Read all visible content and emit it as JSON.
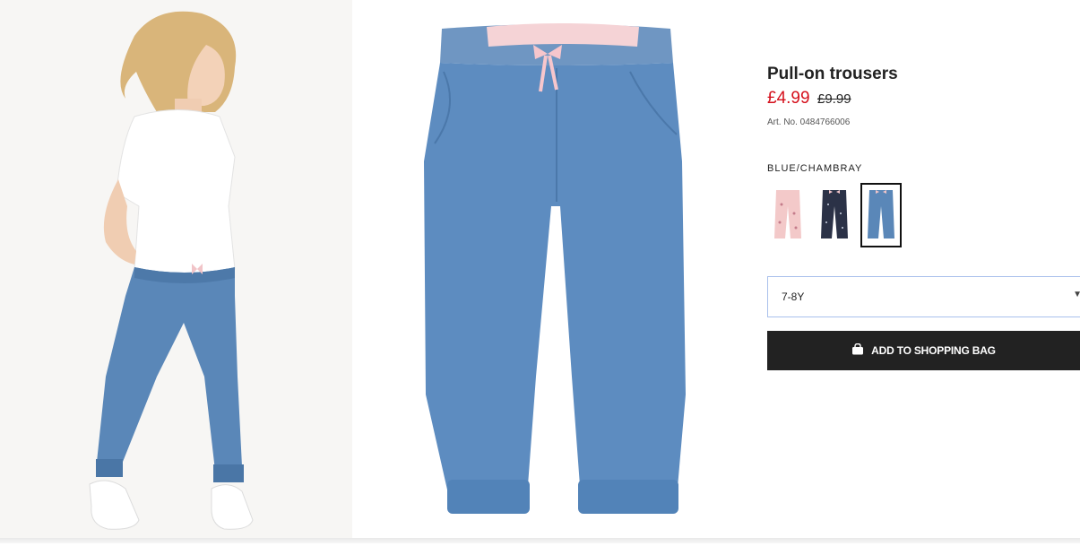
{
  "product": {
    "title": "Pull-on trousers",
    "price_now": "£4.99",
    "price_was": "£9.99",
    "article_number": "Art. No. 0484766006"
  },
  "colour": {
    "label": "BLUE/CHAMBRAY",
    "swatches": [
      {
        "name": "light pink patterned",
        "color": "#f3c9c9",
        "selected": false
      },
      {
        "name": "dark blue dotted",
        "color": "#2b3247",
        "selected": false
      },
      {
        "name": "blue chambray",
        "color": "#4f7fb3",
        "selected": true
      }
    ]
  },
  "size": {
    "selected": "7-8Y"
  },
  "actions": {
    "add_to_bag": "ADD TO SHOPPING BAG"
  },
  "colors": {
    "sale_red": "#d5101c",
    "button_black": "#222222",
    "denim": "#5a87b8"
  }
}
